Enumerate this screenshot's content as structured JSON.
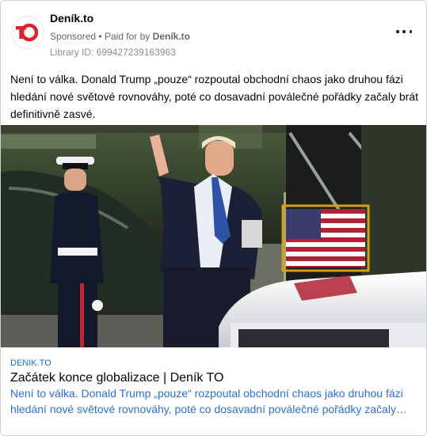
{
  "header": {
    "page_name": "Deník.to",
    "sponsored": "Sponsored",
    "separator": "•",
    "paid_for_by": "Paid for by",
    "payer": "Deník.to",
    "library_id": "Library ID: 699427239163963",
    "more_icon": "more-horizontal-icon",
    "logo_text": "TO",
    "brand_color": "#e0222b"
  },
  "post": {
    "primary_text": "Není to válka. Donald Trump „pouze“ rozpoutal obchodní chaos jako druhou fázi hledání nové světové rovnováhy, poté co dosavadní poválečné pořádky začaly brát definitivně zasvé."
  },
  "link": {
    "domain": "DENIK.TO",
    "headline": "Začátek konce globalizace | Deník TO",
    "description": "Není to válka. Donald Trump „pouze“ rozpoutal obchodní chaos jako druhou fázi hledání nové světové rovnováhy, poté co dosavadní poválečné pořádky začaly brát definitivně zasvé."
  }
}
